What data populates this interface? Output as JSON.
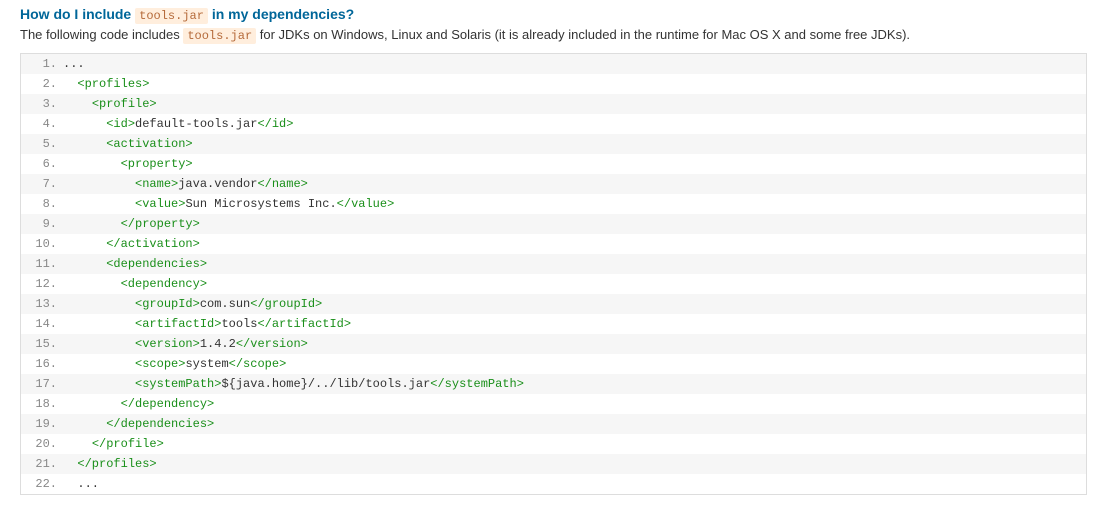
{
  "title_prefix": "How do I include ",
  "title_chip": "tools.jar",
  "title_suffix": " in my dependencies?",
  "desc_prefix": "The following code includes ",
  "desc_chip": "tools.jar",
  "desc_suffix": " for JDKs on Windows, Linux and Solaris (it is already included in the runtime for Mac OS X and some free JDKs).",
  "code_lines": [
    {
      "n": "1.",
      "indent": "",
      "segs": [
        {
          "t": "txt",
          "v": "..."
        }
      ]
    },
    {
      "n": "2.",
      "indent": "  ",
      "segs": [
        {
          "t": "tag",
          "v": "<profiles>"
        }
      ]
    },
    {
      "n": "3.",
      "indent": "    ",
      "segs": [
        {
          "t": "tag",
          "v": "<profile>"
        }
      ]
    },
    {
      "n": "4.",
      "indent": "      ",
      "segs": [
        {
          "t": "tag",
          "v": "<id>"
        },
        {
          "t": "txt",
          "v": "default-tools.jar"
        },
        {
          "t": "tag",
          "v": "</id>"
        }
      ]
    },
    {
      "n": "5.",
      "indent": "      ",
      "segs": [
        {
          "t": "tag",
          "v": "<activation>"
        }
      ]
    },
    {
      "n": "6.",
      "indent": "        ",
      "segs": [
        {
          "t": "tag",
          "v": "<property>"
        }
      ]
    },
    {
      "n": "7.",
      "indent": "          ",
      "segs": [
        {
          "t": "tag",
          "v": "<name>"
        },
        {
          "t": "txt",
          "v": "java.vendor"
        },
        {
          "t": "tag",
          "v": "</name>"
        }
      ]
    },
    {
      "n": "8.",
      "indent": "          ",
      "segs": [
        {
          "t": "tag",
          "v": "<value>"
        },
        {
          "t": "txt",
          "v": "Sun Microsystems Inc."
        },
        {
          "t": "tag",
          "v": "</value>"
        }
      ]
    },
    {
      "n": "9.",
      "indent": "        ",
      "segs": [
        {
          "t": "tag",
          "v": "</property>"
        }
      ]
    },
    {
      "n": "10.",
      "indent": "      ",
      "segs": [
        {
          "t": "tag",
          "v": "</activation>"
        }
      ]
    },
    {
      "n": "11.",
      "indent": "      ",
      "segs": [
        {
          "t": "tag",
          "v": "<dependencies>"
        }
      ]
    },
    {
      "n": "12.",
      "indent": "        ",
      "segs": [
        {
          "t": "tag",
          "v": "<dependency>"
        }
      ]
    },
    {
      "n": "13.",
      "indent": "          ",
      "segs": [
        {
          "t": "tag",
          "v": "<groupId>"
        },
        {
          "t": "txt",
          "v": "com.sun"
        },
        {
          "t": "tag",
          "v": "</groupId>"
        }
      ]
    },
    {
      "n": "14.",
      "indent": "          ",
      "segs": [
        {
          "t": "tag",
          "v": "<artifactId>"
        },
        {
          "t": "txt",
          "v": "tools"
        },
        {
          "t": "tag",
          "v": "</artifactId>"
        }
      ]
    },
    {
      "n": "15.",
      "indent": "          ",
      "segs": [
        {
          "t": "tag",
          "v": "<version>"
        },
        {
          "t": "txt",
          "v": "1.4.2"
        },
        {
          "t": "tag",
          "v": "</version>"
        }
      ]
    },
    {
      "n": "16.",
      "indent": "          ",
      "segs": [
        {
          "t": "tag",
          "v": "<scope>"
        },
        {
          "t": "txt",
          "v": "system"
        },
        {
          "t": "tag",
          "v": "</scope>"
        }
      ]
    },
    {
      "n": "17.",
      "indent": "          ",
      "segs": [
        {
          "t": "tag",
          "v": "<systemPath>"
        },
        {
          "t": "txt",
          "v": "${java.home}/../lib/tools.jar"
        },
        {
          "t": "tag",
          "v": "</systemPath>"
        }
      ]
    },
    {
      "n": "18.",
      "indent": "        ",
      "segs": [
        {
          "t": "tag",
          "v": "</dependency>"
        }
      ]
    },
    {
      "n": "19.",
      "indent": "      ",
      "segs": [
        {
          "t": "tag",
          "v": "</dependencies>"
        }
      ]
    },
    {
      "n": "20.",
      "indent": "    ",
      "segs": [
        {
          "t": "tag",
          "v": "</profile>"
        }
      ]
    },
    {
      "n": "21.",
      "indent": "  ",
      "segs": [
        {
          "t": "tag",
          "v": "</profiles>"
        }
      ]
    },
    {
      "n": "22.",
      "indent": "  ",
      "segs": [
        {
          "t": "txt",
          "v": "..."
        }
      ]
    }
  ]
}
